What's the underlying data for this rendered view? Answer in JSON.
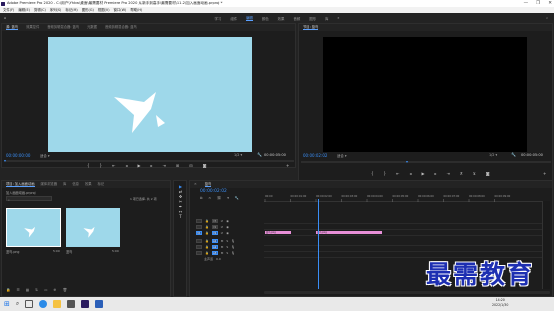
{
  "window": {
    "title": "Adobe Premiere Pro 2020 - C:\\用户\\Yhkw\\桌面\\最需要材 Premiere Pro 2020 从新手到高手\\最需要材\\11.2\\加入画面动画.prproj *",
    "controls": [
      "—",
      "❐",
      "✕"
    ]
  },
  "menu": [
    "文件(F)",
    "编辑(E)",
    "剪辑(C)",
    "序列(S)",
    "标记(M)",
    "图形(G)",
    "视图(V)",
    "窗口(W)",
    "帮助(H)"
  ],
  "workspaces": {
    "items": [
      "学习",
      "组件",
      "编辑",
      "颜色",
      "效果",
      "音频",
      "图形",
      "库"
    ],
    "active": "编辑"
  },
  "source_monitor": {
    "tabs": [
      "源: 蓝鸟",
      "效果控件",
      "音频剪辑混合器: 蓝鸟",
      "元数据",
      "音频剪辑混合器: 蓝鸟"
    ],
    "timecode_left": "00:00:00:00",
    "fit": "适合",
    "ratio": "1/2",
    "timecode_right": "00:00:05:00",
    "bg_color": "#9ed8ea"
  },
  "program_monitor": {
    "tabs": [
      "节目: 蓝鸟"
    ],
    "timecode_left": "00:00:02:02",
    "fit": "适合",
    "ratio": "1/2",
    "timecode_right": "00:00:05:00"
  },
  "project_panel": {
    "tabs": [
      "项目: 加入画面动画",
      "媒体浏览器",
      "库",
      "信息",
      "效果",
      "标记"
    ],
    "project_name": "加入画面动画.prproj",
    "item_count": "1 项已选择, 共 2 项",
    "items": [
      {
        "name": "蓝鸟.png",
        "duration": "5:00"
      },
      {
        "name": "蓝鸟",
        "duration": "5:00"
      }
    ]
  },
  "tools": [
    "▶",
    "⇄",
    "✥",
    "✂",
    "✒",
    "↔",
    "T"
  ],
  "timeline": {
    "tab": "蓝鸟",
    "timecode": "00:00:02:02",
    "ruler": [
      "00:00",
      "00:00:01:00",
      "00:00:02:00",
      "00:00:03:00",
      "00:00:04:00",
      "00:00:05:00",
      "00:00:06:00",
      "00:00:07:00",
      "00:00:08:00",
      "00:00:09:00"
    ],
    "tracks": [
      {
        "label": "V3"
      },
      {
        "label": "V2"
      },
      {
        "label": "V1"
      },
      {
        "label": "A1"
      },
      {
        "label": "A2"
      },
      {
        "label": "A3"
      },
      {
        "label": "主声道",
        "value": "0.0"
      }
    ],
    "clips": [
      {
        "name": "蓝鸟.png",
        "start_sec": 0,
        "end_sec": 1.0
      },
      {
        "name": "蓝鸟.png",
        "start_sec": 2.0,
        "end_sec": 4.6
      }
    ],
    "playhead_sec": 2.07,
    "clip_color": "#e78fd8"
  },
  "taskbar": {
    "time": "14:20",
    "date": "2022/1/30"
  },
  "watermark": "最需教育"
}
